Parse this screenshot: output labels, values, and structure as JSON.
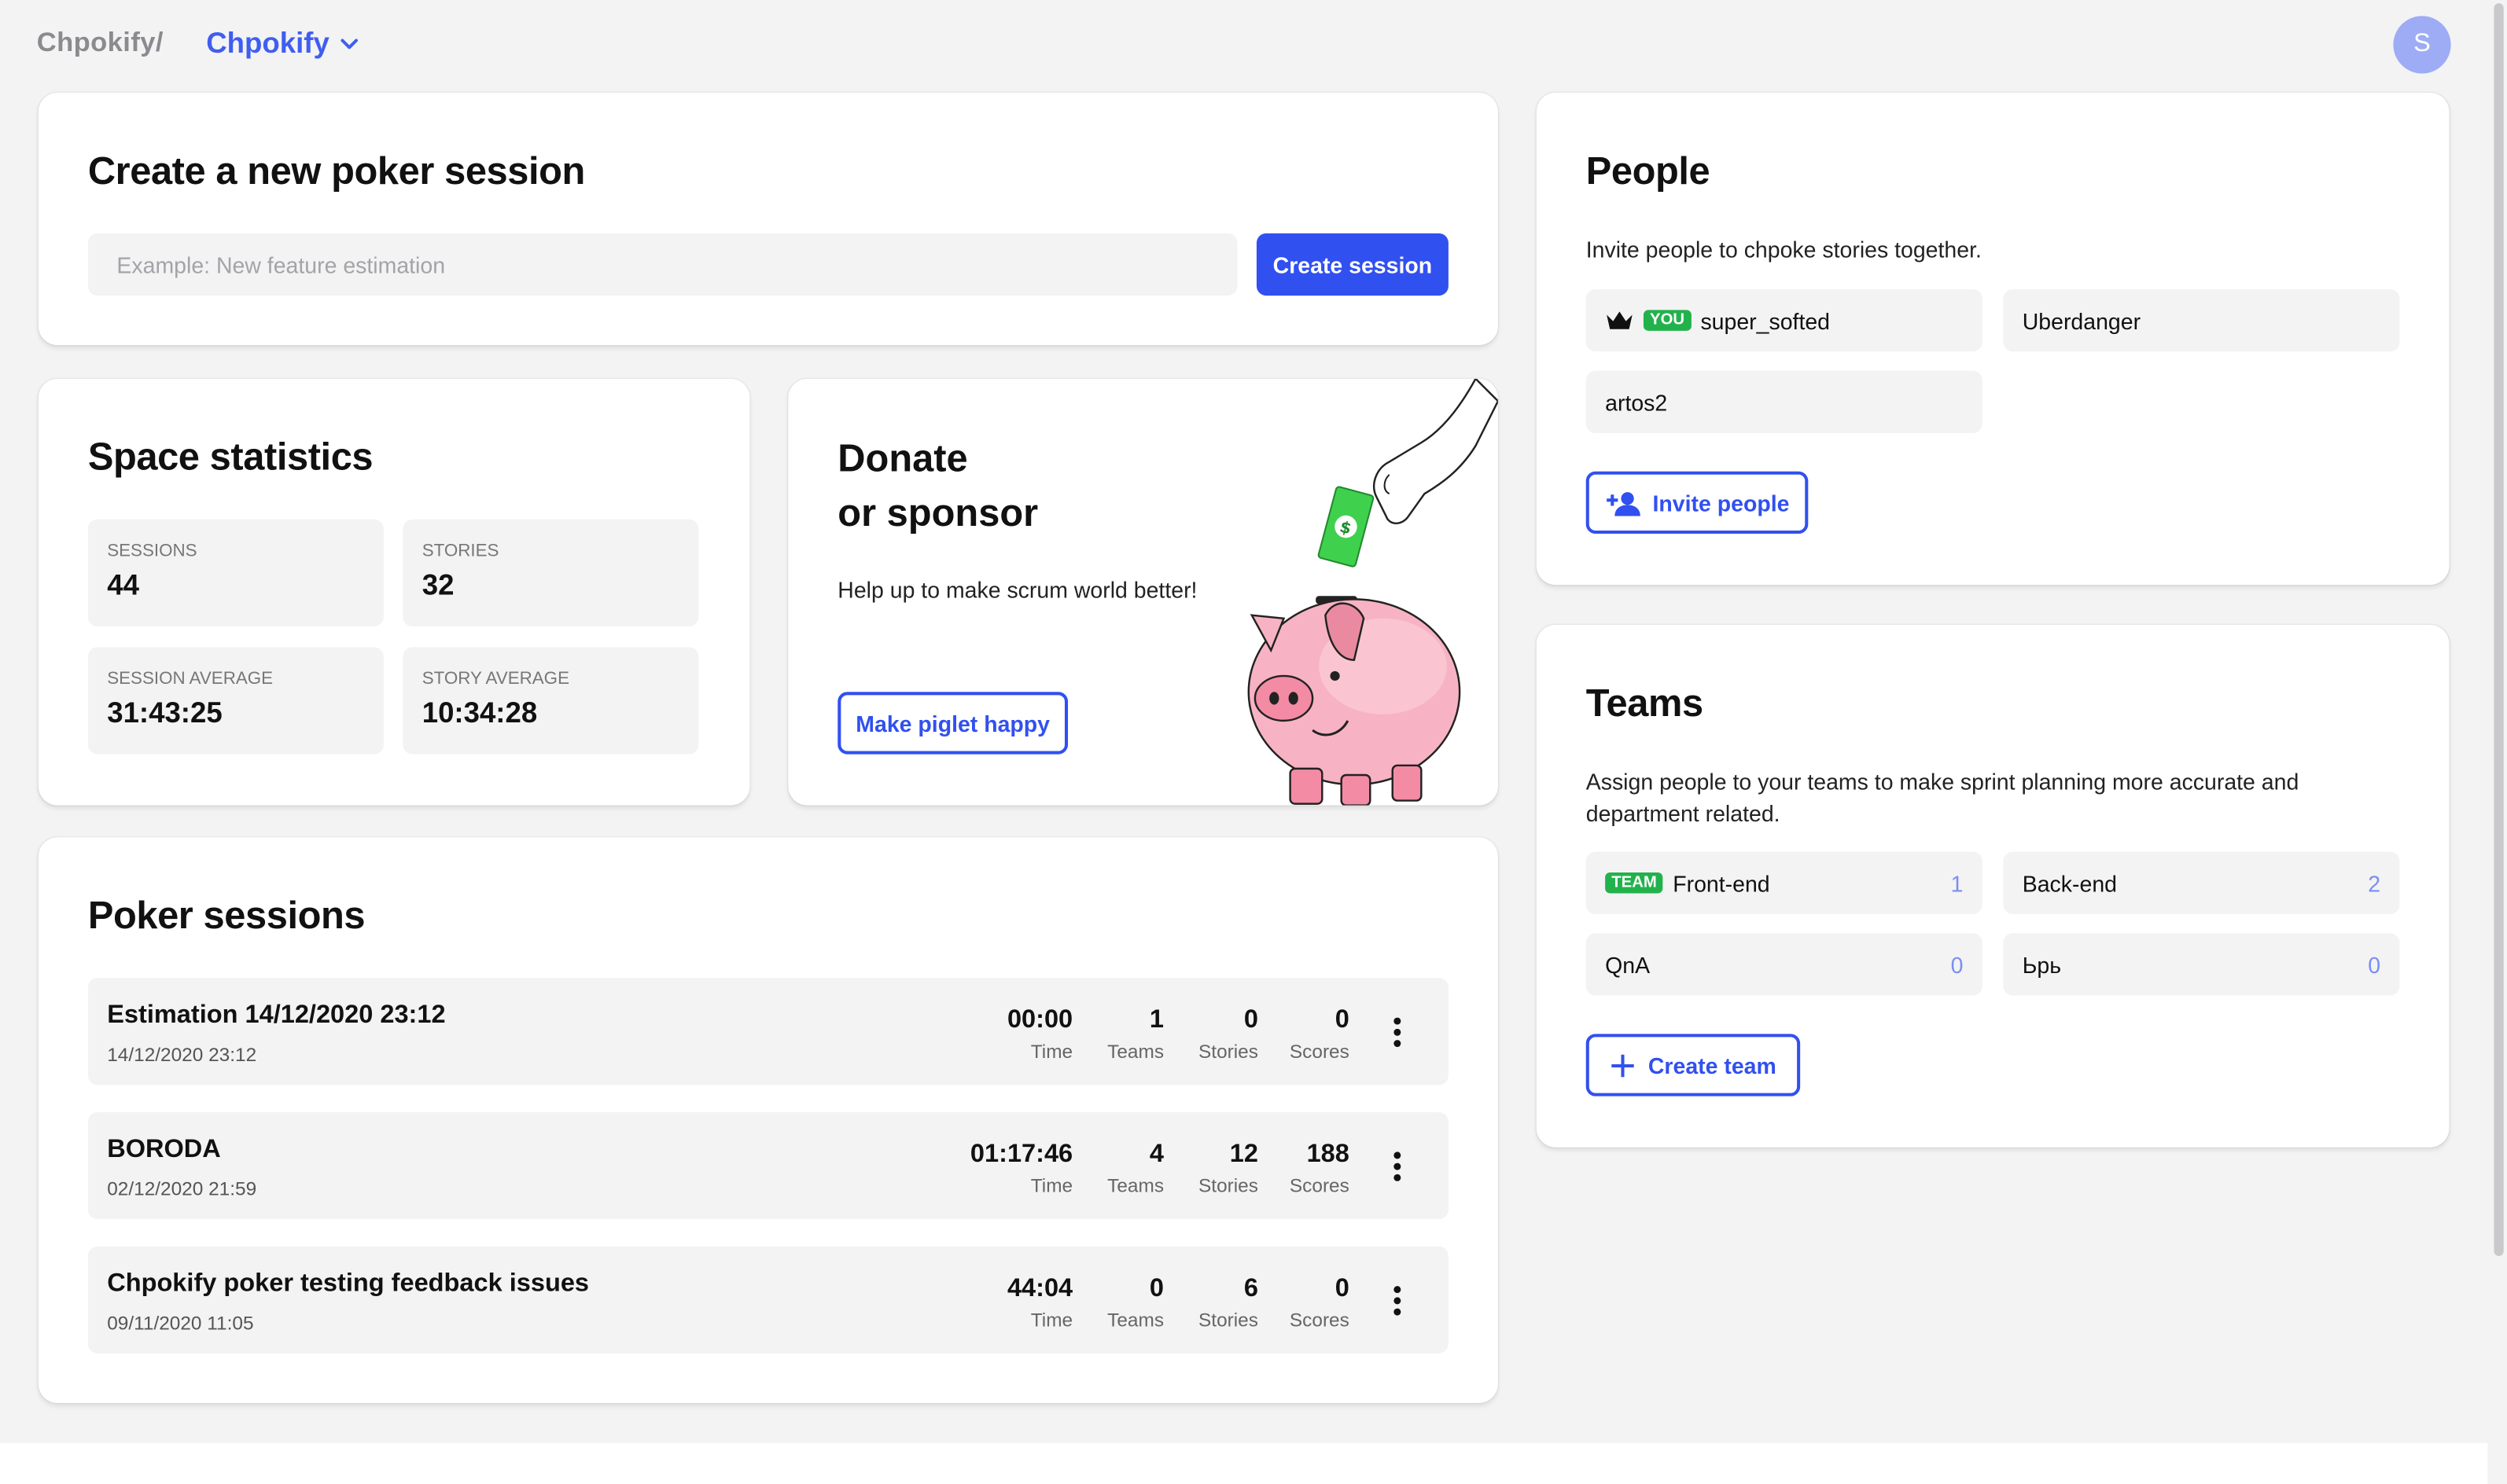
{
  "header": {
    "brand": "Chpokify/",
    "workspace": "Chpokify",
    "avatar_initial": "S"
  },
  "create_session": {
    "title": "Create a new poker session",
    "placeholder": "Example: New feature estimation",
    "button": "Create session"
  },
  "stats": {
    "title": "Space statistics",
    "items": [
      {
        "label": "SESSIONS",
        "value": "44"
      },
      {
        "label": "STORIES",
        "value": "32"
      },
      {
        "label": "SESSION AVERAGE",
        "value": "31:43:25"
      },
      {
        "label": "STORY AVERAGE",
        "value": "10:34:28"
      }
    ]
  },
  "donate": {
    "title_line1": "Donate",
    "title_line2": "or sponsor",
    "text": "Help up to make scrum world better!",
    "button": "Make piglet happy"
  },
  "sessions": {
    "title": "Poker sessions",
    "metric_labels": {
      "time": "Time",
      "teams": "Teams",
      "stories": "Stories",
      "scores": "Scores"
    },
    "rows": [
      {
        "title": "Estimation 14/12/2020 23:12",
        "date": "14/12/2020 23:12",
        "time": "00:00",
        "teams": "1",
        "stories": "0",
        "scores": "0"
      },
      {
        "title": "BORODA",
        "date": "02/12/2020 21:59",
        "time": "01:17:46",
        "teams": "4",
        "stories": "12",
        "scores": "188"
      },
      {
        "title": "Chpokify poker testing feedback issues",
        "date": "09/11/2020 11:05",
        "time": "44:04",
        "teams": "0",
        "stories": "6",
        "scores": "0"
      }
    ]
  },
  "people": {
    "title": "People",
    "description": "Invite people to chpoke stories together.",
    "you_tag": "YOU",
    "members": [
      "super_softed",
      "Uberdanger",
      "artos2"
    ],
    "invite_button": "Invite people"
  },
  "teams": {
    "title": "Teams",
    "description": "Assign people to your teams to make sprint planning more accurate and department related.",
    "team_tag": "TEAM",
    "items": [
      {
        "name": "Front-end",
        "count": "1"
      },
      {
        "name": "Back-end",
        "count": "2"
      },
      {
        "name": "QnA",
        "count": "0"
      },
      {
        "name": "Ьрь",
        "count": "0"
      }
    ],
    "create_button": "Create team"
  },
  "colors": {
    "accent": "#3150f0",
    "tag_green": "#22b24c",
    "background": "#f3f3f4"
  }
}
